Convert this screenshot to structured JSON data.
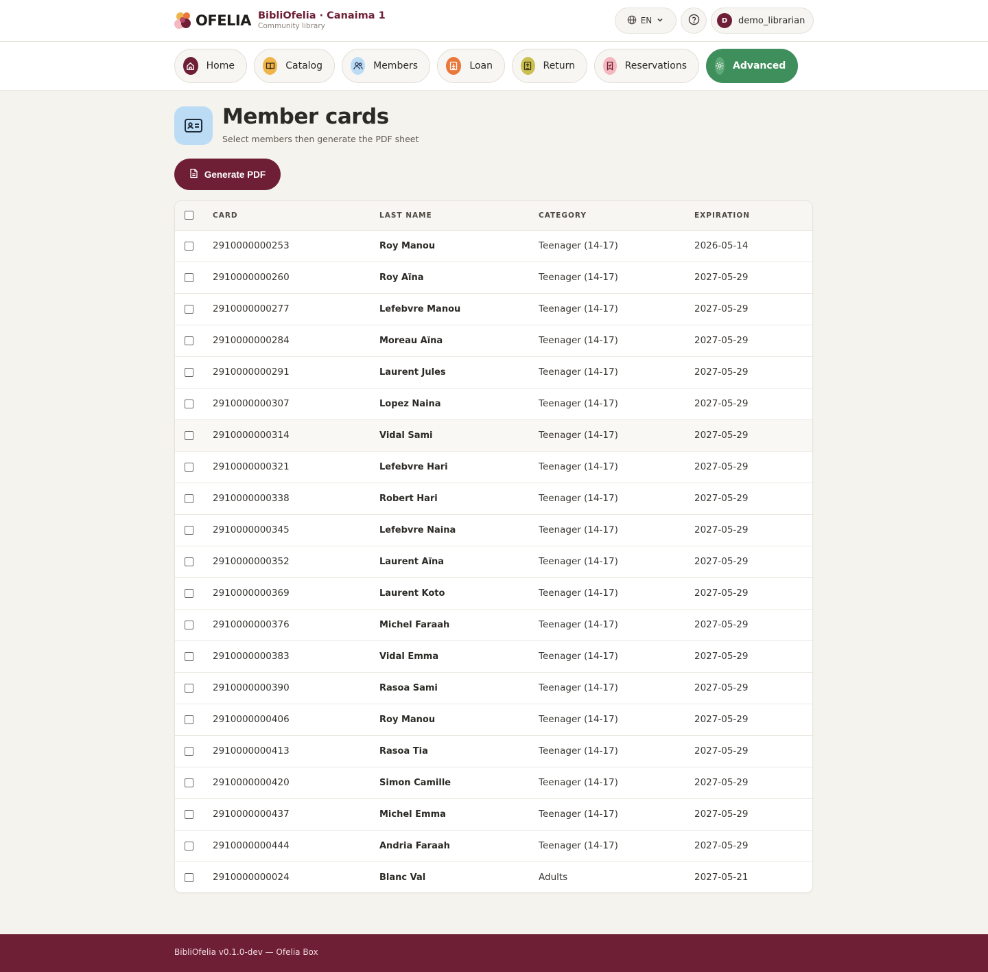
{
  "header": {
    "logo_text": "OFELIA",
    "brand_title": "BibliOfelia · Canaima 1",
    "brand_subtitle": "Community library",
    "language": "EN",
    "user_initial": "D",
    "username": "demo_librarian"
  },
  "nav": {
    "items": [
      {
        "label": "Home",
        "icon": "home-icon",
        "color": "#6e1f36"
      },
      {
        "label": "Catalog",
        "icon": "book-icon",
        "color": "#f0b54a"
      },
      {
        "label": "Members",
        "icon": "users-icon",
        "color": "#bcdcf6"
      },
      {
        "label": "Loan",
        "icon": "loan-icon",
        "color": "#e9783a"
      },
      {
        "label": "Return",
        "icon": "return-icon",
        "color": "#cbbf52"
      },
      {
        "label": "Reservations",
        "icon": "bookmark-icon",
        "color": "#f4b8be"
      },
      {
        "label": "Advanced",
        "icon": "gear-icon",
        "color": "#3f8f5c",
        "active": true
      }
    ]
  },
  "page": {
    "title": "Member cards",
    "subtitle": "Select members then generate the PDF sheet",
    "generate_label": "Generate PDF"
  },
  "table": {
    "columns": [
      "CARD",
      "LAST NAME",
      "CATEGORY",
      "EXPIRATION"
    ],
    "rows": [
      {
        "card": "2910000000253",
        "name": "Roy Manou",
        "category": "Teenager (14-17)",
        "expiration": "2026-05-14"
      },
      {
        "card": "2910000000260",
        "name": "Roy Aïna",
        "category": "Teenager (14-17)",
        "expiration": "2027-05-29"
      },
      {
        "card": "2910000000277",
        "name": "Lefebvre Manou",
        "category": "Teenager (14-17)",
        "expiration": "2027-05-29"
      },
      {
        "card": "2910000000284",
        "name": "Moreau Aïna",
        "category": "Teenager (14-17)",
        "expiration": "2027-05-29"
      },
      {
        "card": "2910000000291",
        "name": "Laurent Jules",
        "category": "Teenager (14-17)",
        "expiration": "2027-05-29"
      },
      {
        "card": "2910000000307",
        "name": "Lopez Naina",
        "category": "Teenager (14-17)",
        "expiration": "2027-05-29"
      },
      {
        "card": "2910000000314",
        "name": "Vidal Sami",
        "category": "Teenager (14-17)",
        "expiration": "2027-05-29"
      },
      {
        "card": "2910000000321",
        "name": "Lefebvre Hari",
        "category": "Teenager (14-17)",
        "expiration": "2027-05-29"
      },
      {
        "card": "2910000000338",
        "name": "Robert Hari",
        "category": "Teenager (14-17)",
        "expiration": "2027-05-29"
      },
      {
        "card": "2910000000345",
        "name": "Lefebvre Naina",
        "category": "Teenager (14-17)",
        "expiration": "2027-05-29"
      },
      {
        "card": "2910000000352",
        "name": "Laurent Aïna",
        "category": "Teenager (14-17)",
        "expiration": "2027-05-29"
      },
      {
        "card": "2910000000369",
        "name": "Laurent Koto",
        "category": "Teenager (14-17)",
        "expiration": "2027-05-29"
      },
      {
        "card": "2910000000376",
        "name": "Michel Faraah",
        "category": "Teenager (14-17)",
        "expiration": "2027-05-29"
      },
      {
        "card": "2910000000383",
        "name": "Vidal Emma",
        "category": "Teenager (14-17)",
        "expiration": "2027-05-29"
      },
      {
        "card": "2910000000390",
        "name": "Rasoa Sami",
        "category": "Teenager (14-17)",
        "expiration": "2027-05-29"
      },
      {
        "card": "2910000000406",
        "name": "Roy Manou",
        "category": "Teenager (14-17)",
        "expiration": "2027-05-29"
      },
      {
        "card": "2910000000413",
        "name": "Rasoa Tia",
        "category": "Teenager (14-17)",
        "expiration": "2027-05-29"
      },
      {
        "card": "2910000000420",
        "name": "Simon Camille",
        "category": "Teenager (14-17)",
        "expiration": "2027-05-29"
      },
      {
        "card": "2910000000437",
        "name": "Michel Emma",
        "category": "Teenager (14-17)",
        "expiration": "2027-05-29"
      },
      {
        "card": "2910000000444",
        "name": "Andria Faraah",
        "category": "Teenager (14-17)",
        "expiration": "2027-05-29"
      },
      {
        "card": "2910000000024",
        "name": "Blanc Val",
        "category": "Adults",
        "expiration": "2027-05-21"
      }
    ]
  },
  "footer": {
    "text": "BibliOfelia v0.1.0-dev — Ofelia Box"
  }
}
